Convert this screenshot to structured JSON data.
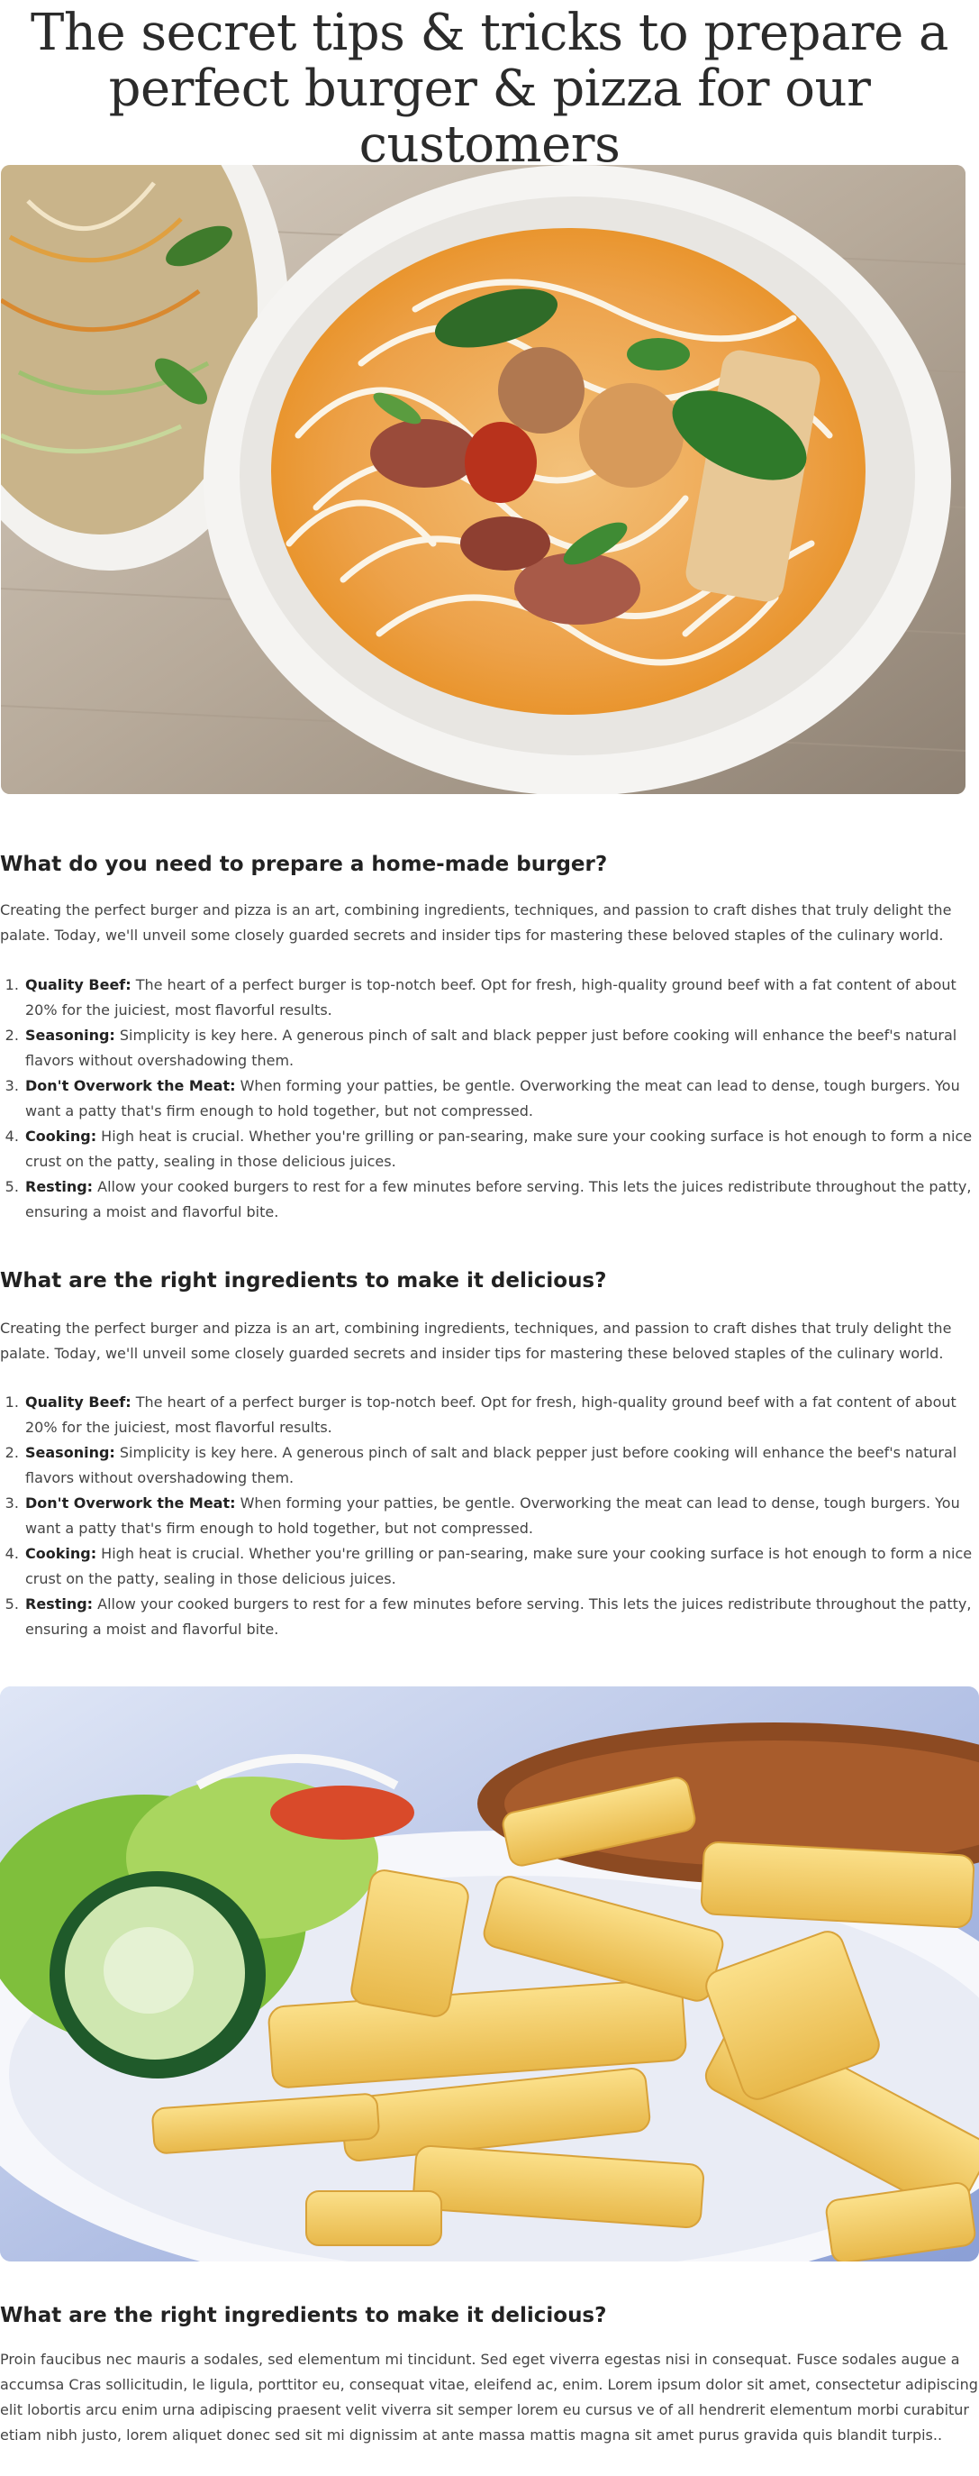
{
  "article": {
    "title": "The secret tips & tricks to prepare a perfect burger & pizza for our customers"
  },
  "sections": [
    {
      "heading": "What do you need to prepare a home-made burger?",
      "intro": "Creating the perfect burger and pizza is an art, combining ingredients, techniques, and passion to craft dishes that truly delight the palate. Today, we'll unveil some closely guarded secrets and insider tips for mastering these beloved staples of the culinary world.",
      "tips": [
        {
          "label": "Quality Beef:",
          "text": " The heart of a perfect burger is top-notch beef. Opt for fresh, high-quality ground beef with a fat content of about 20% for the juiciest, most flavorful results."
        },
        {
          "label": "Seasoning:",
          "text": " Simplicity is key here. A generous pinch of salt and black pepper just before cooking will enhance the beef's natural flavors without overshadowing them."
        },
        {
          "label": "Don't Overwork the Meat:",
          "text": " When forming your patties, be gentle. Overworking the meat can lead to dense, tough burgers. You want a patty that's firm enough to hold together, but not compressed."
        },
        {
          "label": "Cooking:",
          "text": " High heat is crucial. Whether you're grilling or pan-searing, make sure your cooking surface is hot enough to form a nice crust on the patty, sealing in those delicious juices."
        },
        {
          "label": "Resting:",
          "text": " Allow your cooked burgers to rest for a few minutes before serving. This lets the juices redistribute throughout the patty, ensuring a moist and flavorful bite."
        }
      ]
    },
    {
      "heading": "What are the right ingredients to make it delicious?",
      "intro": "Creating the perfect burger and pizza is an art, combining ingredients, techniques, and passion to craft dishes that truly delight the palate. Today, we'll unveil some closely guarded secrets and insider tips for mastering these beloved staples of the culinary world.",
      "tips": [
        {
          "label": "Quality Beef:",
          "text": " The heart of a perfect burger is top-notch beef. Opt for fresh, high-quality ground beef with a fat content of about 20% for the juiciest, most flavorful results."
        },
        {
          "label": "Seasoning:",
          "text": " Simplicity is key here. A generous pinch of salt and black pepper just before cooking will enhance the beef's natural flavors without overshadowing them."
        },
        {
          "label": "Don't Overwork the Meat:",
          "text": " When forming your patties, be gentle. Overworking the meat can lead to dense, tough burgers. You want a patty that's firm enough to hold together, but not compressed."
        },
        {
          "label": "Cooking:",
          "text": " High heat is crucial. Whether you're grilling or pan-searing, make sure your cooking surface is hot enough to form a nice crust on the patty, sealing in those delicious juices."
        },
        {
          "label": "Resting:",
          "text": " Allow your cooked burgers to rest for a few minutes before serving. This lets the juices redistribute throughout the patty, ensuring a moist and flavorful bite."
        }
      ]
    },
    {
      "heading": "What are the right ingredients to make it delicious?",
      "body": "Proin faucibus nec mauris a sodales, sed elementum mi tincidunt. Sed eget viverra egestas nisi in consequat. Fusce sodales augue a accumsa Cras sollicitudin, le ligula, porttitor eu, consequat vitae, eleifend ac, enim. Lorem ipsum dolor sit amet, consectetur adipiscing elit lobortis arcu enim urna adipiscing praesent velit viverra sit semper lorem eu cursus ve of all hendrerit elementum morbi curabitur etiam nibh justo, lorem aliquet donec sed sit mi dignissim at ante massa mattis magna sit amet purus gravida quis blandit turpis.."
    }
  ],
  "colors": {
    "heading": "#222222",
    "body": "#444444",
    "title": "#2b2b2b"
  }
}
